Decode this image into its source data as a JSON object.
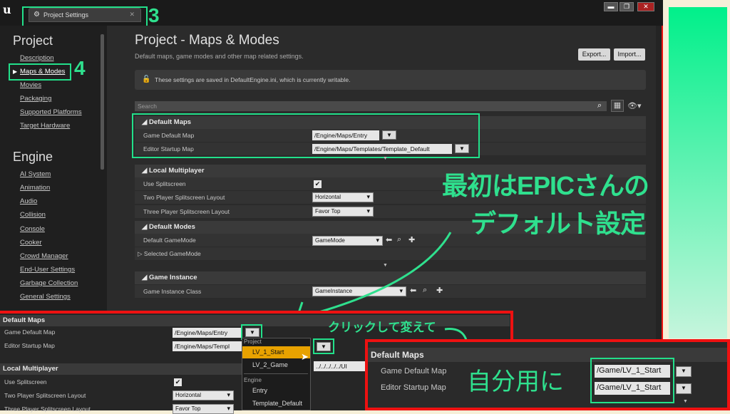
{
  "window": {
    "tab_title": "Project Settings",
    "ue_logo": "u",
    "controls": [
      "▬",
      "❐",
      "✕"
    ]
  },
  "sidebar": {
    "project_header": "Project",
    "project_items": [
      {
        "label": "Description"
      },
      {
        "label": "Maps & Modes",
        "selected": true
      },
      {
        "label": "Movies"
      },
      {
        "label": "Packaging"
      },
      {
        "label": "Supported Platforms"
      },
      {
        "label": "Target Hardware"
      }
    ],
    "engine_header": "Engine",
    "engine_items": [
      {
        "label": "AI System"
      },
      {
        "label": "Animation"
      },
      {
        "label": "Audio"
      },
      {
        "label": "Collision"
      },
      {
        "label": "Console"
      },
      {
        "label": "Cooker"
      },
      {
        "label": "Crowd Manager"
      },
      {
        "label": "End-User Settings"
      },
      {
        "label": "Garbage Collection"
      },
      {
        "label": "General Settings"
      }
    ]
  },
  "main": {
    "title": "Project - Maps & Modes",
    "subtitle": "Default maps, game modes and other map related settings.",
    "export_label": "Export...",
    "import_label": "Import...",
    "notice": "These settings are saved in DefaultEngine.ini, which is currently writable.",
    "search_placeholder": "Search",
    "default_maps": {
      "header": "Default Maps",
      "game_default_map_label": "Game Default Map",
      "game_default_map_value": "/Engine/Maps/Entry",
      "editor_startup_map_label": "Editor Startup Map",
      "editor_startup_map_value": "/Engine/Maps/Templates/Template_Default"
    },
    "local_multiplayer": {
      "header": "Local Multiplayer",
      "use_splitscreen_label": "Use Splitscreen",
      "use_splitscreen_checked": true,
      "two_player_label": "Two Player Splitscreen Layout",
      "two_player_value": "Horizontal",
      "three_player_label": "Three Player Splitscreen Layout",
      "three_player_value": "Favor Top"
    },
    "default_modes": {
      "header": "Default Modes",
      "default_gamemode_label": "Default GameMode",
      "default_gamemode_value": "GameMode",
      "selected_gamemode_label": "Selected GameMode"
    },
    "game_instance": {
      "header": "Game Instance",
      "class_label": "Game Instance Class",
      "class_value": "GameInstance"
    }
  },
  "bottom_panel": {
    "default_maps_header": "Default Maps",
    "game_default_map_label": "Game Default Map",
    "game_default_map_value": "/Engine/Maps/Entry",
    "editor_startup_map_label": "Editor Startup Map",
    "editor_startup_map_value": "/Engine/Maps/Templ",
    "path_value": "../../../../../UI",
    "local_multiplayer_header": "Local Multiplayer",
    "use_splitscreen_label": "Use Splitscreen",
    "two_player_label": "Two Player Splitscreen Layout",
    "two_player_value": "Horizontal",
    "three_player_label": "Three Player Splitscreen Layout",
    "three_player_value": "Favor Top"
  },
  "dropdown_menu": {
    "project_header": "Project",
    "items_project": [
      "LV_1_Start",
      "LV_2_Game"
    ],
    "engine_header": "Engine",
    "items_engine": [
      "Entry",
      "Template_Default"
    ],
    "highlighted": "LV_1_Start"
  },
  "zoom_panel": {
    "header": "Default Maps",
    "game_default_map_label": "Game Default Map",
    "game_default_map_value": "/Game/LV_1_Start",
    "editor_startup_map_label": "Editor Startup Map",
    "editor_startup_map_value": "/Game/LV_1_Start"
  },
  "annotations": {
    "num3": "3",
    "num4": "4",
    "caption_line1": "最初はEPICさんの",
    "caption_line2": "デフォルト設定",
    "click_caption": "クリックして変えて",
    "handwritten": "自分用に"
  },
  "colors": {
    "annotation_green": "#2fe08e",
    "frame_red": "#e11111",
    "highlight_orange": "#e8a200"
  }
}
